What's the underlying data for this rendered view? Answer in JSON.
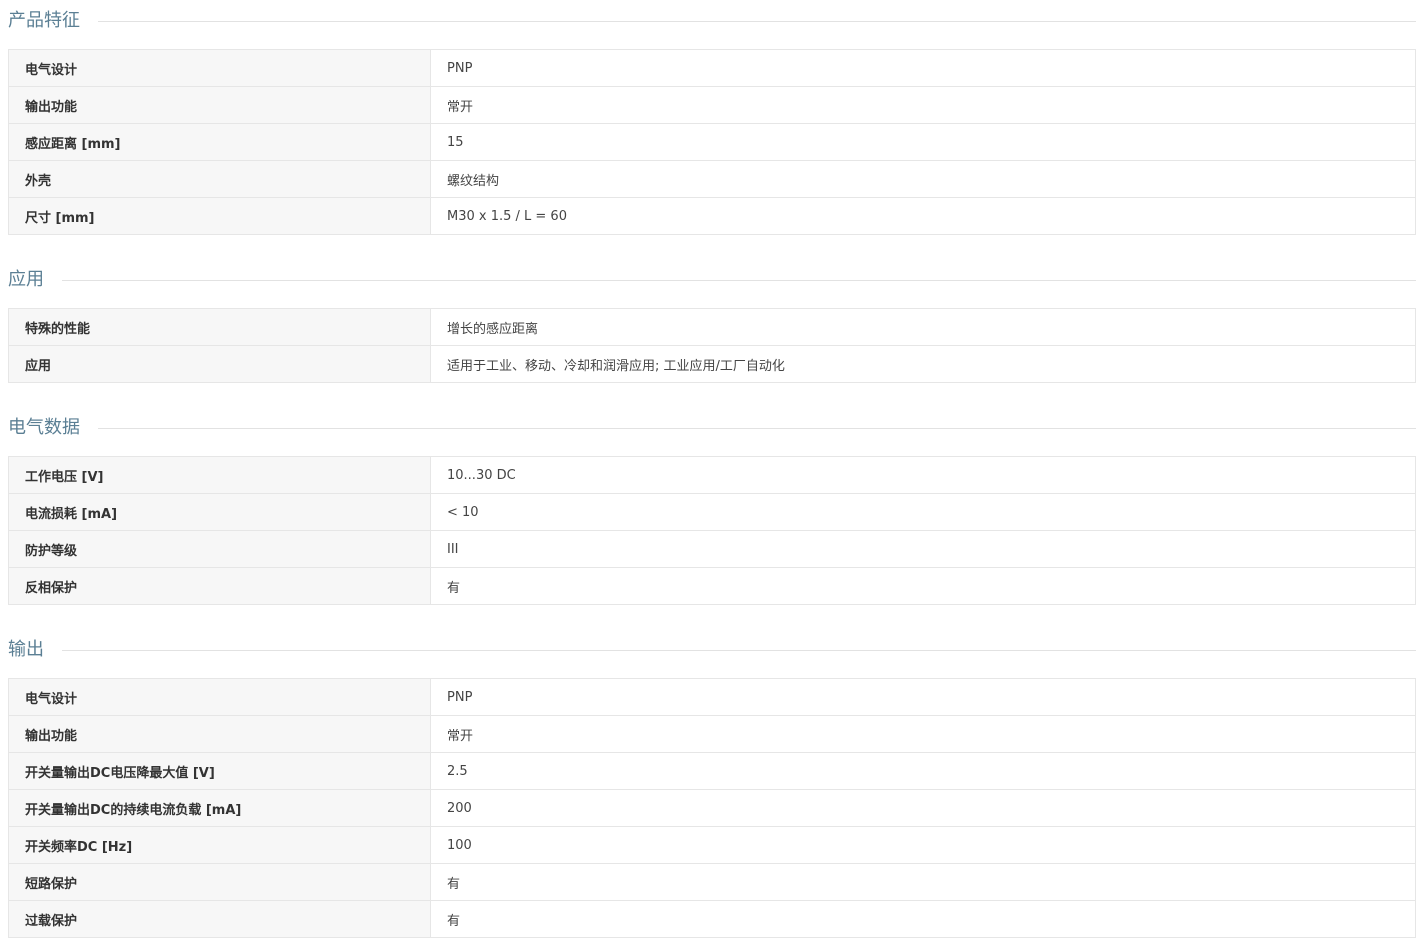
{
  "sections": [
    {
      "title": "产品特征",
      "rows": [
        {
          "label": "电气设计",
          "value": "PNP"
        },
        {
          "label": "输出功能",
          "value": "常开"
        },
        {
          "label": "感应距离 [mm]",
          "value": "15"
        },
        {
          "label": "外壳",
          "value": "螺纹结构"
        },
        {
          "label": "尺寸 [mm]",
          "value": "M30 x 1.5 / L = 60"
        }
      ]
    },
    {
      "title": "应用",
      "rows": [
        {
          "label": "特殊的性能",
          "value": "增长的感应距离"
        },
        {
          "label": "应用",
          "value": "适用于工业、移动、冷却和润滑应用; 工业应用/工厂自动化"
        }
      ]
    },
    {
      "title": "电气数据",
      "rows": [
        {
          "label": "工作电压 [V]",
          "value": "10...30 DC"
        },
        {
          "label": "电流损耗 [mA]",
          "value": "< 10"
        },
        {
          "label": "防护等级",
          "value": "III"
        },
        {
          "label": "反相保护",
          "value": "有"
        }
      ]
    },
    {
      "title": "输出",
      "rows": [
        {
          "label": "电气设计",
          "value": "PNP"
        },
        {
          "label": "输出功能",
          "value": "常开"
        },
        {
          "label": "开关量输出DC电压降最大值 [V]",
          "value": "2.5"
        },
        {
          "label": "开关量输出DC的持续电流负载 [mA]",
          "value": "200"
        },
        {
          "label": "开关频率DC [Hz]",
          "value": "100"
        },
        {
          "label": "短路保护",
          "value": "有"
        },
        {
          "label": "过载保护",
          "value": "有"
        }
      ]
    }
  ]
}
